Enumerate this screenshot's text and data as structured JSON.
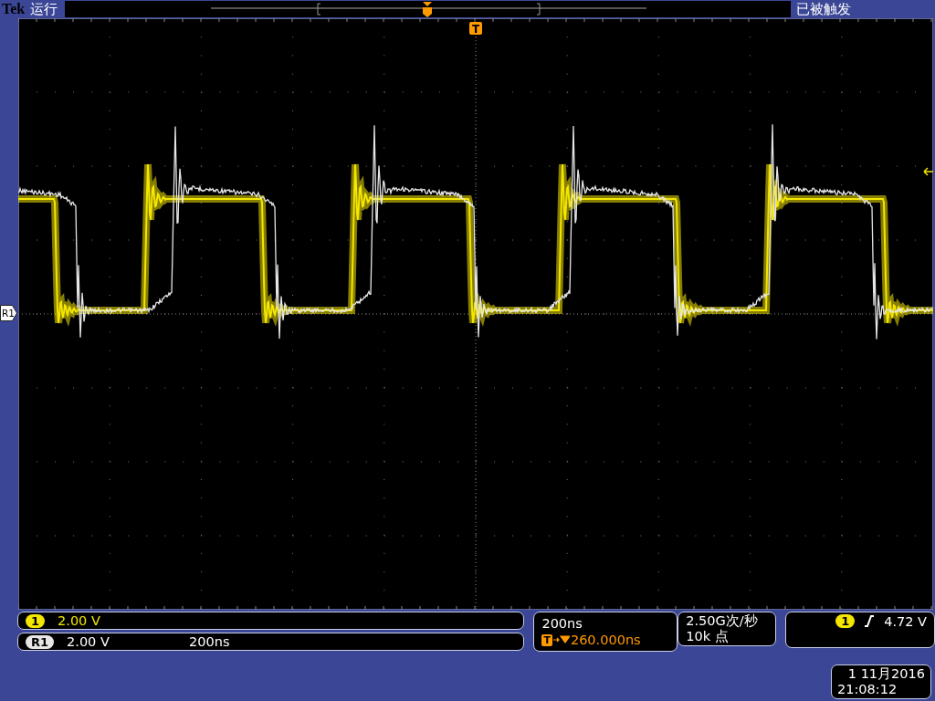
{
  "header": {
    "brand": "Tek",
    "run_state": "运行",
    "trigger_status": "已被触发"
  },
  "markers": {
    "trigger_position": "T",
    "reference": "R1"
  },
  "channels": [
    {
      "label": "1",
      "kind": "live",
      "color": "#f4e600",
      "scale": "2.00 V"
    },
    {
      "label": "R1",
      "kind": "reference",
      "color": "#e6e6e6",
      "scale": "2.00 V",
      "timebase": "200ns"
    }
  ],
  "horizontal": {
    "scale": "200ns",
    "trigger_label": "T",
    "delay": "260.000ns"
  },
  "acquisition": {
    "sample_rate": "2.50G次/秒",
    "record_length": "10k 点"
  },
  "trigger": {
    "source": "1",
    "level": "4.72 V"
  },
  "datetime": {
    "date": "1 11月2016",
    "time": "21:08:12"
  }
}
